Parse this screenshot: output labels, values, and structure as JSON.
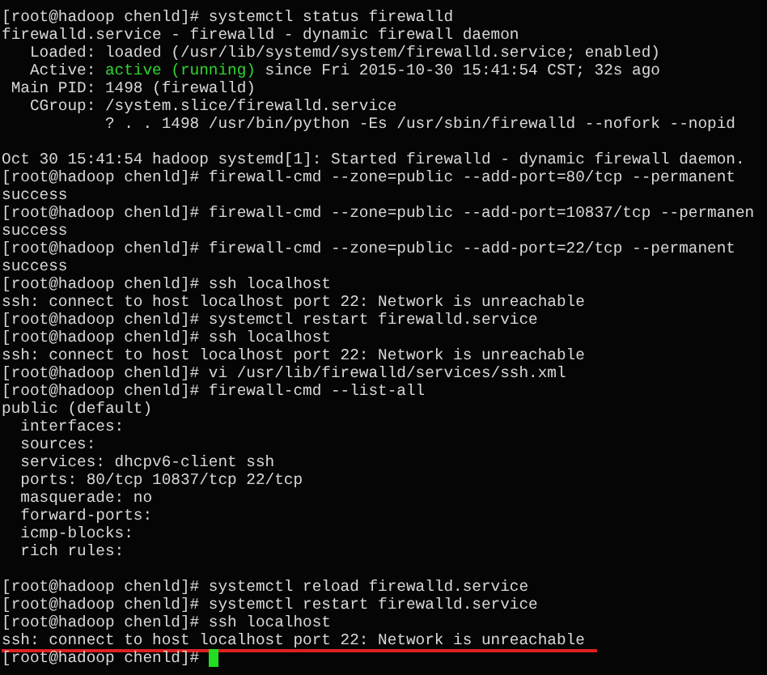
{
  "terminal": {
    "lines": [
      {
        "kind": "text",
        "text": "[root@hadoop chenld]# systemctl status firewalld"
      },
      {
        "kind": "text",
        "text": "firewalld.service - firewalld - dynamic firewall daemon"
      },
      {
        "kind": "text",
        "text": "   Loaded: loaded (/usr/lib/systemd/system/firewalld.service; enabled)"
      },
      {
        "kind": "status",
        "parts": [
          {
            "text": "   Active: ",
            "highlighted": false
          },
          {
            "text": "active (running)",
            "highlighted": true
          },
          {
            "text": " since Fri 2015-10-30 15:41:54 CST; 32s ago",
            "highlighted": false
          }
        ]
      },
      {
        "kind": "text",
        "text": " Main PID: 1498 (firewalld)"
      },
      {
        "kind": "text",
        "text": "   CGroup: /system.slice/firewalld.service"
      },
      {
        "kind": "text",
        "text": "           ? . . 1498 /usr/bin/python -Es /usr/sbin/firewalld --nofork --nopid"
      },
      {
        "kind": "blank"
      },
      {
        "kind": "text",
        "text": "Oct 30 15:41:54 hadoop systemd[1]: Started firewalld - dynamic firewall daemon."
      },
      {
        "kind": "text",
        "text": "[root@hadoop chenld]# firewall-cmd --zone=public --add-port=80/tcp --permanent"
      },
      {
        "kind": "text",
        "text": "success"
      },
      {
        "kind": "text",
        "text": "[root@hadoop chenld]# firewall-cmd --zone=public --add-port=10837/tcp --permanen"
      },
      {
        "kind": "text",
        "text": "success"
      },
      {
        "kind": "text",
        "text": "[root@hadoop chenld]# firewall-cmd --zone=public --add-port=22/tcp --permanent"
      },
      {
        "kind": "text",
        "text": "success"
      },
      {
        "kind": "text",
        "text": "[root@hadoop chenld]# ssh localhost"
      },
      {
        "kind": "text",
        "text": "ssh: connect to host localhost port 22: Network is unreachable"
      },
      {
        "kind": "text",
        "text": "[root@hadoop chenld]# systemctl restart firewalld.service"
      },
      {
        "kind": "text",
        "text": "[root@hadoop chenld]# ssh localhost"
      },
      {
        "kind": "text",
        "text": "ssh: connect to host localhost port 22: Network is unreachable"
      },
      {
        "kind": "text",
        "text": "[root@hadoop chenld]# vi /usr/lib/firewalld/services/ssh.xml"
      },
      {
        "kind": "text",
        "text": "[root@hadoop chenld]# firewall-cmd --list-all"
      },
      {
        "kind": "text",
        "text": "public (default)"
      },
      {
        "kind": "text",
        "text": "  interfaces:"
      },
      {
        "kind": "text",
        "text": "  sources:"
      },
      {
        "kind": "text",
        "text": "  services: dhcpv6-client ssh"
      },
      {
        "kind": "text",
        "text": "  ports: 80/tcp 10837/tcp 22/tcp"
      },
      {
        "kind": "text",
        "text": "  masquerade: no"
      },
      {
        "kind": "text",
        "text": "  forward-ports:"
      },
      {
        "kind": "text",
        "text": "  icmp-blocks:"
      },
      {
        "kind": "text",
        "text": "  rich rules:"
      },
      {
        "kind": "blank"
      },
      {
        "kind": "text",
        "text": "[root@hadoop chenld]# systemctl reload firewalld.service"
      },
      {
        "kind": "text",
        "text": "[root@hadoop chenld]# systemctl restart firewalld.service"
      },
      {
        "kind": "text",
        "text": "[root@hadoop chenld]# ssh localhost"
      },
      {
        "kind": "underlined",
        "text": "ssh: connect to host localhost port 22: Network is unreachable"
      },
      {
        "kind": "cursor",
        "text": "[root@hadoop chenld]# "
      }
    ]
  }
}
